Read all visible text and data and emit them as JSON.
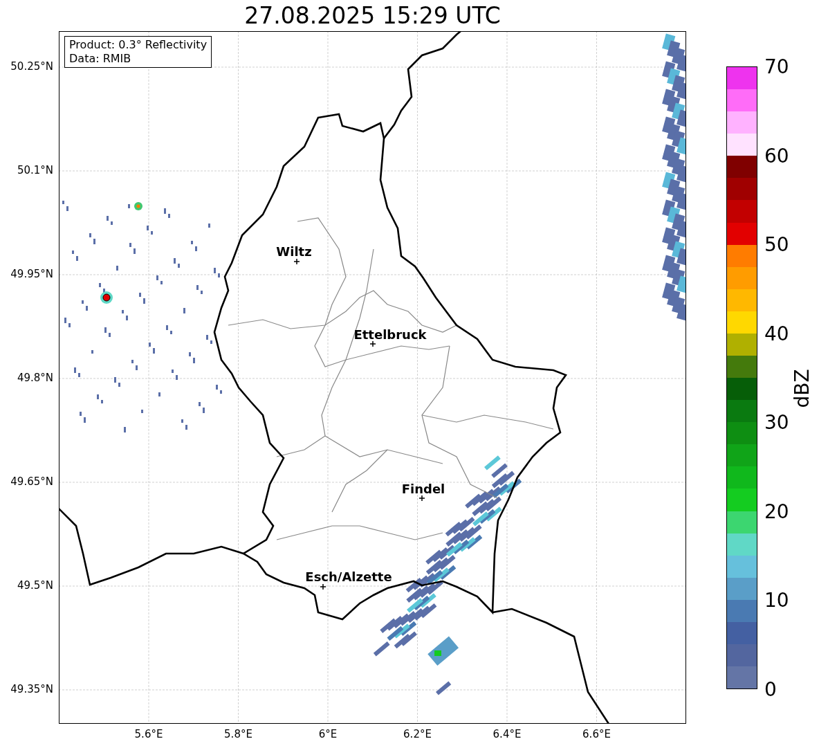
{
  "title": "27.08.2025 15:29 UTC",
  "map": {
    "info": [
      "Product: 0.3° Reflectivity",
      "Data: RMIB"
    ],
    "yticks": [
      "50.25°N",
      "50.1°N",
      "49.95°N",
      "49.8°N",
      "49.65°N",
      "49.5°N",
      "49.35°N"
    ],
    "xticks": [
      "5.6°E",
      "5.8°E",
      "6°E",
      "6.2°E",
      "6.4°E",
      "6.6°E"
    ],
    "cities": [
      {
        "name": "Wiltz"
      },
      {
        "name": "Ettelbruck"
      },
      {
        "name": "Findel"
      },
      {
        "name": "Esch/Alzette"
      }
    ]
  },
  "colorbar": {
    "label": "dBZ",
    "ticks": [
      "70",
      "60",
      "50",
      "40",
      "30",
      "20",
      "10",
      "0"
    ],
    "bins": [
      {
        "color": "#ee33ee"
      },
      {
        "color": "#ff6cf8"
      },
      {
        "color": "#ffb2ff"
      },
      {
        "color": "#ffe2ff"
      },
      {
        "color": "#800000"
      },
      {
        "color": "#a00000"
      },
      {
        "color": "#c20000"
      },
      {
        "color": "#e20000"
      },
      {
        "color": "#ff7c00"
      },
      {
        "color": "#ff9c00"
      },
      {
        "color": "#ffb800"
      },
      {
        "color": "#ffd800"
      },
      {
        "color": "#b0b000"
      },
      {
        "color": "#447a0c"
      },
      {
        "color": "#065e08"
      },
      {
        "color": "#0a7a10"
      },
      {
        "color": "#0e8e12"
      },
      {
        "color": "#10a418"
      },
      {
        "color": "#10b81c"
      },
      {
        "color": "#14cc20"
      },
      {
        "color": "#3cd670"
      },
      {
        "color": "#60d8c6"
      },
      {
        "color": "#66c0dc"
      },
      {
        "color": "#5a9ec8"
      },
      {
        "color": "#4a7ab2"
      },
      {
        "color": "#4460a2"
      },
      {
        "color": "#53669f"
      },
      {
        "color": "#6475a6"
      }
    ]
  }
}
